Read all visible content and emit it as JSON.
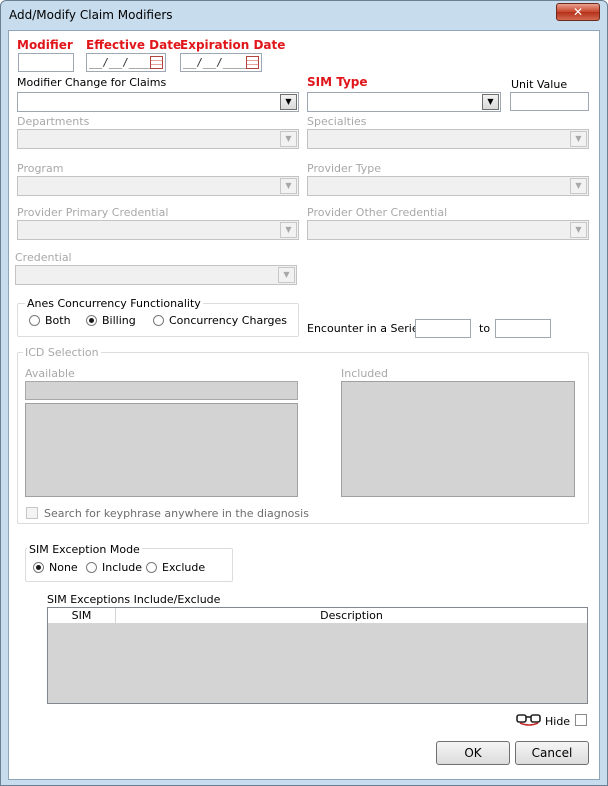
{
  "window": {
    "title": "Add/Modify Claim Modifiers",
    "close_label": "✕"
  },
  "fields": {
    "modifier_label": "Modifier",
    "effective_date_label": "Effective Date",
    "effective_date_value": "__/__/____",
    "expiration_date_label": "Expiration Date",
    "expiration_date_value": "__/__/____",
    "modifier_change_label": "Modifier Change for Claims",
    "sim_type_label": "SIM Type",
    "unit_value_label": "Unit Value",
    "departments_label": "Departments",
    "specialties_label": "Specialties",
    "program_label": "Program",
    "provider_type_label": "Provider Type",
    "provider_primary_credential_label": "Provider Primary Credential",
    "provider_other_credential_label": "Provider Other Credential",
    "credential_label": "Credential"
  },
  "anes": {
    "group_label": "Anes Concurrency Functionality",
    "options": [
      "Both",
      "Billing",
      "Concurrency Charges"
    ],
    "selected": "Billing"
  },
  "encounter": {
    "label": "Encounter in a Series",
    "to_label": "to"
  },
  "icd": {
    "group_label": "ICD Selection",
    "available_label": "Available",
    "included_label": "Included",
    "search_checkbox_label": "Search for keyphrase anywhere in the diagnosis"
  },
  "sim_exception": {
    "group_label": "SIM Exception Mode",
    "options": [
      "None",
      "Include",
      "Exclude"
    ],
    "selected": "None"
  },
  "sim_exceptions_grid": {
    "label": "SIM Exceptions Include/Exclude",
    "columns": [
      "SIM",
      "Description"
    ]
  },
  "footer": {
    "hide_label": "Hide",
    "ok_label": "OK",
    "cancel_label": "Cancel"
  },
  "icons": [
    "calendar-icon",
    "glasses-icon",
    "dropdown-arrow-icon",
    "close-icon"
  ]
}
